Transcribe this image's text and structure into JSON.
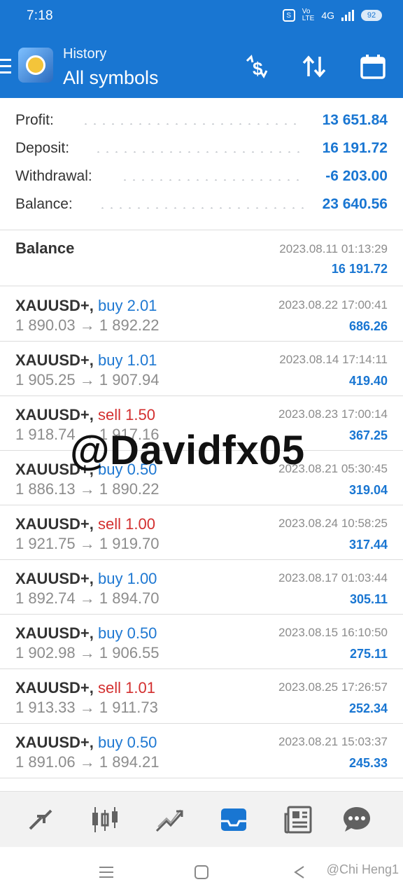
{
  "status": {
    "time": "7:18",
    "network": "4G",
    "battery": "92"
  },
  "header": {
    "subtitle": "History",
    "title": "All symbols"
  },
  "summary": [
    {
      "label": "Profit:",
      "value": "13 651.84"
    },
    {
      "label": "Deposit:",
      "value": "16 191.72"
    },
    {
      "label": "Withdrawal:",
      "value": "-6 203.00"
    },
    {
      "label": "Balance:",
      "value": "23 640.56"
    }
  ],
  "balance_entry": {
    "title": "Balance",
    "datetime": "2023.08.11 01:13:29",
    "amount": "16 191.72"
  },
  "trades": [
    {
      "symbol": "XAUUSD+,",
      "side": "buy",
      "volume": "2.01",
      "open": "1 890.03",
      "close": "1 892.22",
      "datetime": "2023.08.22 17:00:41",
      "profit": "686.26"
    },
    {
      "symbol": "XAUUSD+,",
      "side": "buy",
      "volume": "1.01",
      "open": "1 905.25",
      "close": "1 907.94",
      "datetime": "2023.08.14 17:14:11",
      "profit": "419.40"
    },
    {
      "symbol": "XAUUSD+,",
      "side": "sell",
      "volume": "1.50",
      "open": "1 918.74",
      "close": "1 917.16",
      "datetime": "2023.08.23 17:00:14",
      "profit": "367.25"
    },
    {
      "symbol": "XAUUSD+,",
      "side": "buy",
      "volume": "0.50",
      "open": "1 886.13",
      "close": "1 890.22",
      "datetime": "2023.08.21 05:30:45",
      "profit": "319.04"
    },
    {
      "symbol": "XAUUSD+,",
      "side": "sell",
      "volume": "1.00",
      "open": "1 921.75",
      "close": "1 919.70",
      "datetime": "2023.08.24 10:58:25",
      "profit": "317.44"
    },
    {
      "symbol": "XAUUSD+,",
      "side": "buy",
      "volume": "1.00",
      "open": "1 892.74",
      "close": "1 894.70",
      "datetime": "2023.08.17 01:03:44",
      "profit": "305.11"
    },
    {
      "symbol": "XAUUSD+,",
      "side": "buy",
      "volume": "0.50",
      "open": "1 902.98",
      "close": "1 906.55",
      "datetime": "2023.08.15 16:10:50",
      "profit": "275.11"
    },
    {
      "symbol": "XAUUSD+,",
      "side": "sell",
      "volume": "1.01",
      "open": "1 913.33",
      "close": "1 911.73",
      "datetime": "2023.08.25 17:26:57",
      "profit": "252.34"
    },
    {
      "symbol": "XAUUSD+,",
      "side": "buy",
      "volume": "0.50",
      "open": "1 891.06",
      "close": "1 894.21",
      "datetime": "2023.08.21 15:03:37",
      "profit": "245.33"
    }
  ],
  "watermark": "@Davidfx05",
  "credit": "@Chi Heng1",
  "colors": {
    "primary": "#1976d2",
    "sell": "#d32f2f",
    "muted": "#8c8c8c"
  },
  "bottom_nav": [
    "quotes-icon",
    "chart-icon",
    "trade-icon",
    "history-icon",
    "news-icon",
    "chat-icon"
  ],
  "bottom_nav_active": "history-icon"
}
